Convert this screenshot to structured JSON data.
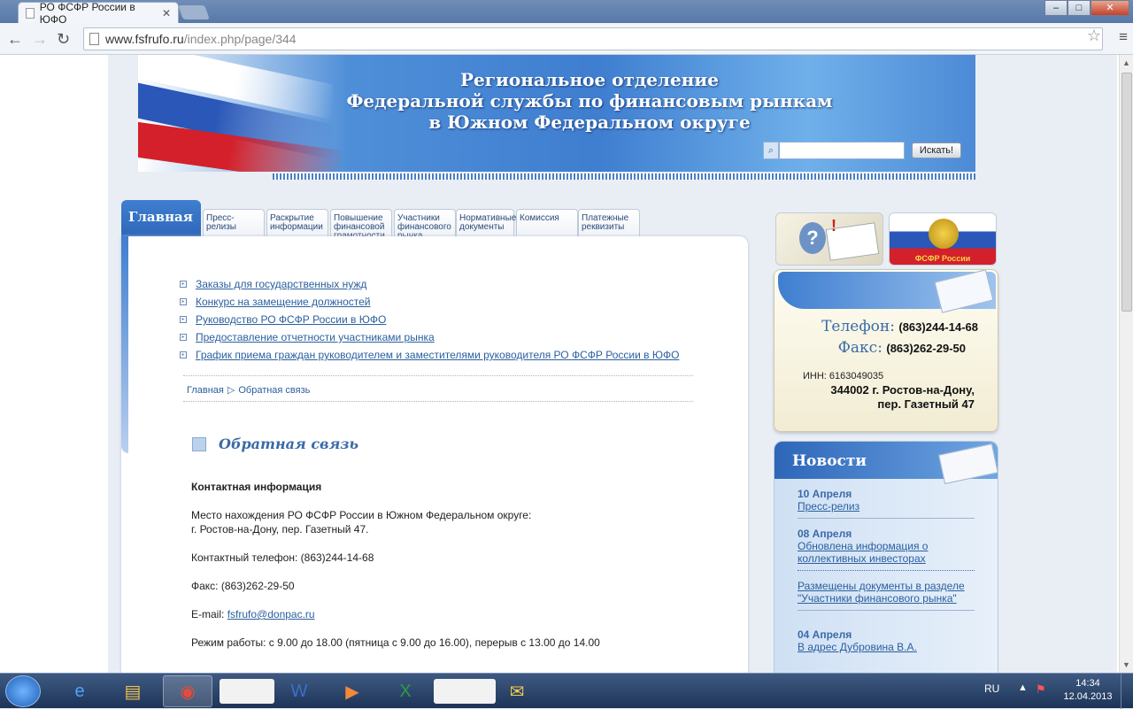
{
  "browser": {
    "tab_title": "РО ФСФР России в ЮФО",
    "tab_close": "✕",
    "url_host": "www.fsfrufo.ru",
    "url_path": "/index.php/page/344"
  },
  "banner": {
    "title_line1": "Региональное отделение",
    "title_line2": "Федеральной службы по финансовым рынкам",
    "title_line3": "в Южном Федеральном округе",
    "search_placeholder": "",
    "search_button": "Искать!"
  },
  "tabs": {
    "main": "Главная",
    "items": [
      "Пресс-\nрелизы",
      "Раскрытие\nинформации",
      "Повышение\nфинансовой\nграмотности",
      "Участники\nфинансового\nрынка",
      "Нормативные\nдокументы",
      "Комиссия",
      "Платежные\nреквизиты"
    ]
  },
  "menu": [
    "Заказы для государственных нужд",
    "Конкурс на замещение должностей",
    "Руководство РО ФСФР России в ЮФО",
    "Предоставление отчетности участниками рынка",
    "График приема граждан руководителем и заместителями руководителя РО ФСФР России в ЮФО"
  ],
  "breadcrumb": {
    "home": "Главная",
    "separator": "▷",
    "current": "Обратная связь"
  },
  "page": {
    "heading": "Обратная связь",
    "contact_heading": "Контактная информация",
    "location_line1": "Место нахождения РО ФСФР России в Южном Федеральном округе:",
    "location_line2": "г. Ростов-на-Дону, пер. Газетный 47.",
    "phone": "Контактный телефон: (863)244-14-68",
    "fax": "Факс: (863)262-29-50",
    "email_label": "E-mail:",
    "email": "fsfrufo@donpac.ru",
    "hours": "Режим работы: с 9.00 до 18.00 (пятница с 9.00 до 16.00), перерыв с 13.00 до 14.00"
  },
  "sidebar": {
    "promo2_label": "ФСФР России",
    "contact": {
      "phone_label": "Телефон:",
      "phone_value": "(863)244-14-68",
      "fax_label": "Факс:",
      "fax_value": "(863)262-29-50",
      "inn": "ИНН: 6163049035",
      "address_line1": "344002 г. Ростов-на-Дону,",
      "address_line2": "пер. Газетный 47"
    },
    "news": {
      "title": "Новости",
      "items": [
        {
          "date": "10 Апреля",
          "text": "Пресс-релиз"
        },
        {
          "date": "08 Апреля",
          "text": "Обновлена информация о коллективных инвесторах"
        },
        {
          "date": "",
          "text": "Размещены документы в разделе \"Участники финансового рынка\""
        },
        {
          "date": "04 Апреля",
          "text": "В адрес Дубровина В.А."
        }
      ]
    }
  },
  "taskbar": {
    "lang": "RU",
    "time": "14:34",
    "date": "12.04.2013"
  },
  "colors": {
    "accent": "#3f7ed0",
    "link": "#2a5f9e",
    "heading_blue": "#3a6aa8"
  }
}
